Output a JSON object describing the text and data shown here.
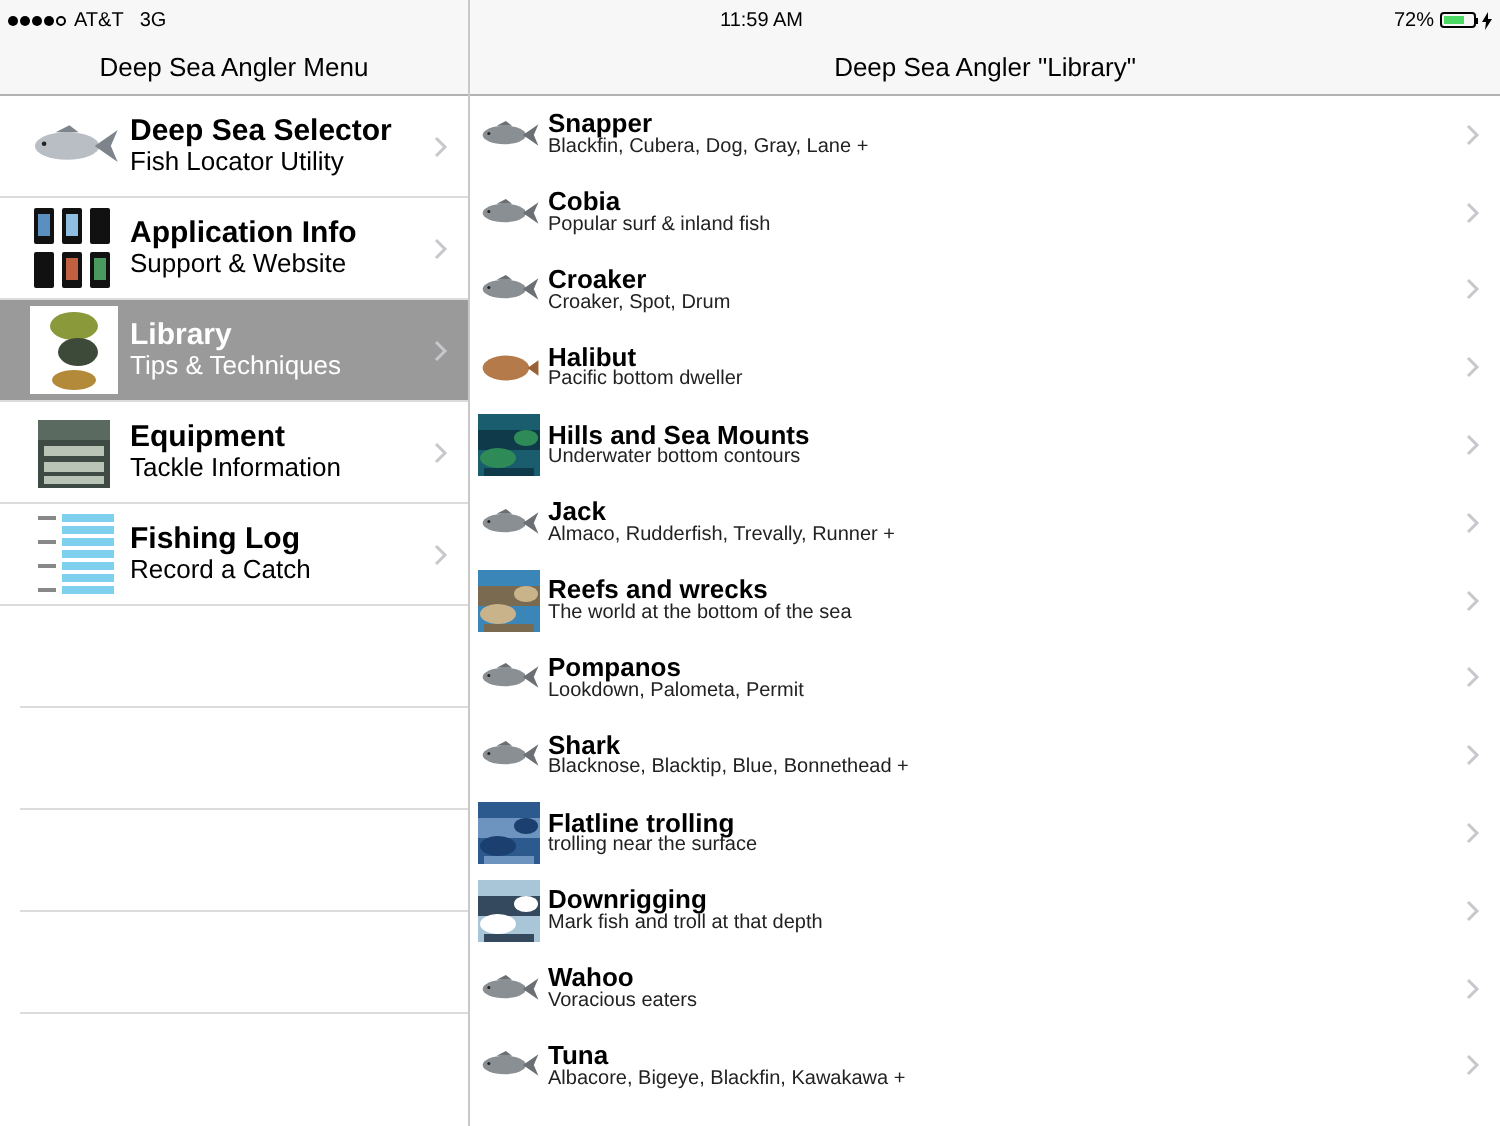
{
  "status_bar": {
    "carrier": "AT&T",
    "network": "3G",
    "time": "11:59 AM",
    "battery": "72%"
  },
  "menu": {
    "title": "Deep Sea Angler Menu",
    "items": [
      {
        "title": "Deep Sea Selector",
        "subtitle": "Fish Locator Utility",
        "kind": "fish",
        "selected": false
      },
      {
        "title": "Application Info",
        "subtitle": "Support & Website",
        "kind": "phones",
        "selected": false
      },
      {
        "title": "Library",
        "subtitle": "Tips & Techniques",
        "kind": "collage",
        "selected": true
      },
      {
        "title": "Equipment",
        "subtitle": "Tackle Information",
        "kind": "tackle",
        "selected": false
      },
      {
        "title": "Fishing Log",
        "subtitle": "Record a Catch",
        "kind": "log",
        "selected": false
      }
    ]
  },
  "library": {
    "title": "Deep Sea Angler \"Library\"",
    "items": [
      {
        "title": "Snapper",
        "subtitle": "Blackfin, Cubera, Dog, Gray, Lane +",
        "kind": "fish"
      },
      {
        "title": "Cobia",
        "subtitle": "Popular surf & inland fish",
        "kind": "fish"
      },
      {
        "title": "Croaker",
        "subtitle": "Croaker, Spot, Drum",
        "kind": "fish"
      },
      {
        "title": "Halibut",
        "subtitle": "Pacific bottom dweller",
        "kind": "flatfish"
      },
      {
        "title": "Hills and Sea Mounts",
        "subtitle": "Underwater bottom contours",
        "kind": "picture"
      },
      {
        "title": "Jack",
        "subtitle": "Almaco, Rudderfish, Trevally, Runner +",
        "kind": "fish"
      },
      {
        "title": "Reefs and wrecks",
        "subtitle": "The world at the bottom of the sea",
        "kind": "picture"
      },
      {
        "title": "Pompanos",
        "subtitle": "Lookdown, Palometa, Permit",
        "kind": "fish"
      },
      {
        "title": "Shark",
        "subtitle": "Blacknose, Blacktip, Blue, Bonnethead +",
        "kind": "fish"
      },
      {
        "title": "Flatline trolling",
        "subtitle": "trolling near the surface",
        "kind": "picture"
      },
      {
        "title": "Downrigging",
        "subtitle": "Mark fish and troll at that depth",
        "kind": "picture"
      },
      {
        "title": "Wahoo",
        "subtitle": "Voracious eaters",
        "kind": "fish"
      },
      {
        "title": "Tuna",
        "subtitle": "Albacore, Bigeye, Blackfin, Kawakawa +",
        "kind": "fish"
      }
    ]
  }
}
